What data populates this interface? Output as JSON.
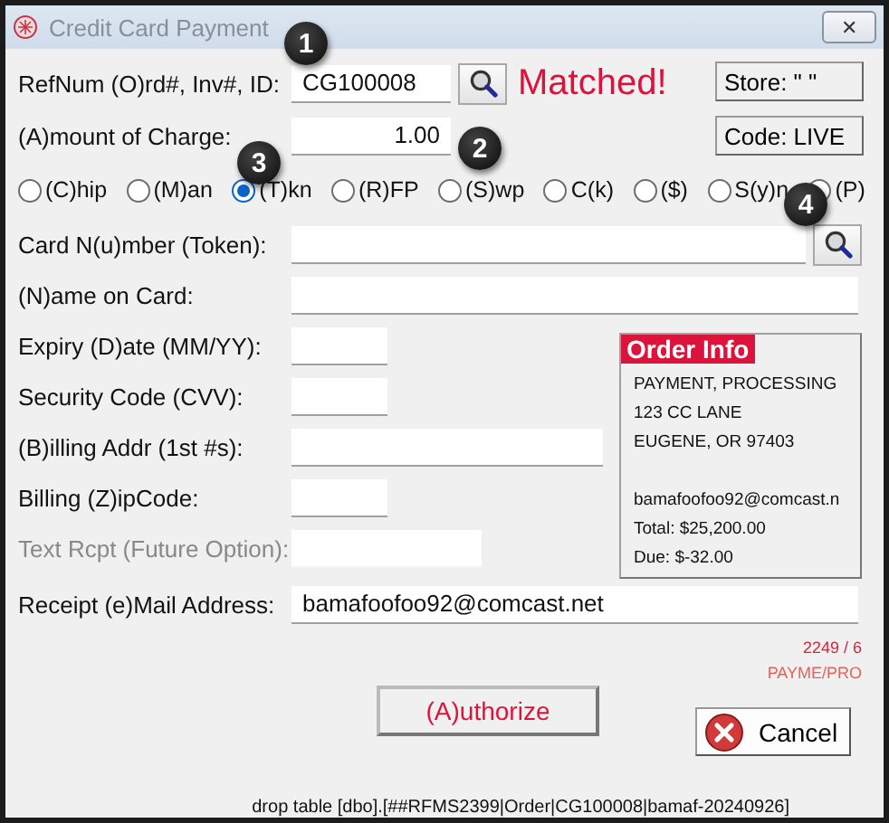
{
  "window": {
    "title": "Credit Card Payment",
    "close": "✕"
  },
  "ref": {
    "label": "RefNum (O)rd#, Inv#, ID:",
    "value": "CG100008",
    "status": "Matched!"
  },
  "amount": {
    "label": "(A)mount of Charge:",
    "value": "1.00"
  },
  "side_buttons": [
    "Store: \" \"",
    "Code: LIVE"
  ],
  "payment_modes": [
    {
      "label": "(C)hip",
      "selected": false
    },
    {
      "label": "(M)an",
      "selected": false
    },
    {
      "label": "(T)kn",
      "selected": true
    },
    {
      "label": "(R)FP",
      "selected": false
    },
    {
      "label": "(S)wp",
      "selected": false
    },
    {
      "label": "C(k)",
      "selected": false
    },
    {
      "label": "($)",
      "selected": false
    },
    {
      "label": "S(y)n",
      "selected": false
    },
    {
      "label": "(P)",
      "selected": false
    }
  ],
  "card_fields": [
    {
      "label": "Card N(u)mber (Token):",
      "kind": "search",
      "disabled": false
    },
    {
      "label": "(N)ame on Card:",
      "kind": "full",
      "disabled": false
    }
  ],
  "detail_fields": [
    {
      "label": "Expiry (D)ate (MM/YY):",
      "kind": "short",
      "disabled": false
    },
    {
      "label": "Security Code (CVV):",
      "kind": "short",
      "disabled": false
    },
    {
      "label": "(B)illing Addr (1st #s):",
      "kind": "long",
      "disabled": false
    },
    {
      "label": "Billing (Z)ipCode:",
      "kind": "short",
      "disabled": false
    },
    {
      "label": "Text Rcpt (Future Option):",
      "kind": "medium",
      "disabled": true
    }
  ],
  "order_info": {
    "title": "Order Info",
    "address_lines": [
      "PAYMENT, PROCESSING",
      "123 CC LANE",
      "EUGENE, OR  97403"
    ],
    "detail_lines": [
      "bamafoofoo92@comcast.n",
      "Total: $25,200.00",
      "Due: $-32.00"
    ]
  },
  "email": {
    "label": "Receipt (e)Mail Address:",
    "value": "bamafoofoo92@comcast.net"
  },
  "counter": "2249 / 6",
  "user": "PAYME/PRO",
  "authorize": "(A)uthorize",
  "cancel": "Cancel",
  "footer": "drop table [dbo].[##RFMS2399|Order|CG100008|bamaf-20240926]",
  "callouts": [
    {
      "label": "1"
    },
    {
      "label": "2"
    },
    {
      "label": "3"
    },
    {
      "label": "4"
    }
  ]
}
